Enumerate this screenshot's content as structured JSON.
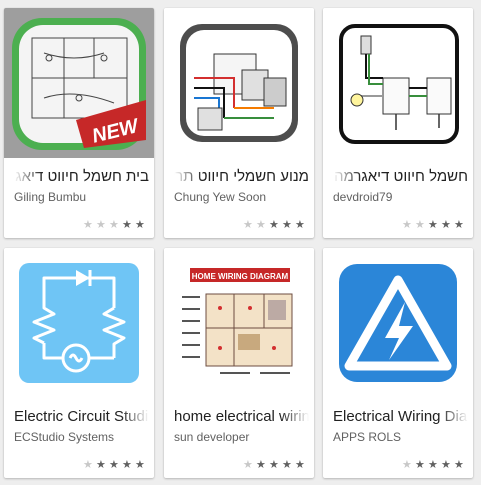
{
  "apps": [
    {
      "title": "בית חשמל חיווט דיאגרמה",
      "developer": "Giling Bumbu",
      "rating": 2,
      "icon": "house-wiring-plan-new-icon"
    },
    {
      "title": "מנוע חשמלי חיווט תרשים",
      "developer": "Chung Yew Soon",
      "rating": 3,
      "icon": "motor-wiring-diagram-icon"
    },
    {
      "title": "חשמל חיווט דיאגרמה",
      "developer": "devdroid79",
      "rating": 3,
      "icon": "outlet-wiring-diagram-icon"
    },
    {
      "title": "Electric Circuit Studio",
      "developer": "ECStudio Systems",
      "rating": 4,
      "icon": "electric-circuit-icon"
    },
    {
      "title": "home electrical wiring",
      "developer": "sun developer",
      "rating": 4,
      "icon": "home-floorplan-wiring-icon",
      "icon_text": "HOME WIRING DIAGRAM"
    },
    {
      "title": "Electrical Wiring Diagram",
      "developer": "APPS ROLS",
      "rating": 4,
      "icon": "high-voltage-warning-icon"
    }
  ],
  "colors": {
    "background": "#eeeeee",
    "accent_blue": "#6fc5f5",
    "voltage_blue": "#2b86d8",
    "new_badge": "#c62828"
  }
}
